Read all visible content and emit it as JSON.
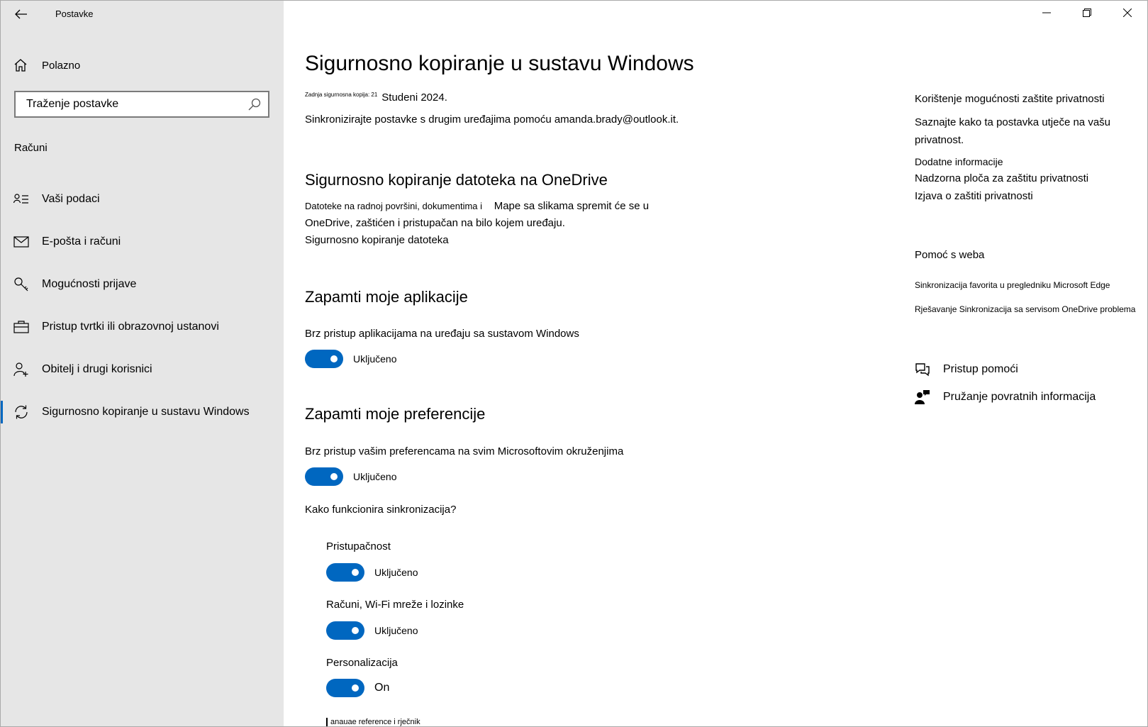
{
  "app": {
    "title": "Postavke"
  },
  "sidebar": {
    "home_label": "Polazno",
    "search_placeholder": "Traženje postavke",
    "section_label": "Računi",
    "items": [
      {
        "label": "Vaši podaci",
        "icon": "person-list-icon"
      },
      {
        "label": "E-pošta i računi",
        "icon": "mail-icon"
      },
      {
        "label": "Mogućnosti prijave",
        "icon": "key-icon"
      },
      {
        "label": "Pristup tvrtki ili obrazovnoj ustanovi",
        "icon": "briefcase-icon"
      },
      {
        "label": "Obitelj i drugi korisnici",
        "icon": "add-person-icon"
      },
      {
        "label": "Sigurnosno kopiranje u sustavu Windows",
        "icon": "sync-icon",
        "active": true
      }
    ]
  },
  "main": {
    "title": "Sigurnosno kopiranje u sustavu Windows",
    "last_backup_prefix": "Zadnja sigurnosna kopija: 21",
    "last_backup_date": "Studeni 2024.",
    "sync_description": "Sinkronizirajte postavke s drugim uređajima pomoću amanda.brady@outlook.it.",
    "onedrive": {
      "heading": "Sigurnosno kopiranje datoteka na OneDrive",
      "desc_part1": "Datoteke na radnoj površini, dokumentima i",
      "desc_part2": "Mape sa slikama spremit će se u",
      "desc_line2": "OneDrive, zaštićen i pristupačan na bilo kojem uređaju.",
      "link": "Sigurnosno kopiranje datoteka"
    },
    "apps": {
      "heading": "Zapamti moje aplikacije",
      "description": "Brz pristup aplikacijama na uređaju sa sustavom Windows",
      "toggle_label": "Uključeno",
      "toggle_on": true
    },
    "preferences": {
      "heading": "Zapamti moje preferencije",
      "description": "Brz pristup vašim preferencama na svim Microsoftovim okruženjima",
      "toggle_label": "Uključeno",
      "toggle_on": true,
      "how_sync_link": "Kako funkcionira sinkronizacija?",
      "sub_settings": [
        {
          "label": "Pristupačnost",
          "toggle_label": "Uključeno",
          "on": true
        },
        {
          "label": "Računi, Wi-Fi mreže i lozinke",
          "toggle_label": "Uključeno",
          "on": true
        },
        {
          "label": "Personalizacija",
          "toggle_label": "On",
          "on": true
        }
      ],
      "cut_off_label": "anauae reference i rječnik"
    }
  },
  "right_panel": {
    "privacy_heading": "Korištenje mogućnosti zaštite privatnosti",
    "privacy_text": "Saznajte kako ta postavka utječe na vašu privatnost.",
    "more_info": "Dodatne informacije",
    "privacy_dashboard": "Nadzorna ploča za zaštitu privatnosti",
    "privacy_statement": "Izjava o zaštiti privatnosti",
    "web_help_heading": "Pomoć s weba",
    "web_help_links": [
      "Sinkronizacija favorita u pregledniku Microsoft Edge",
      "Rješavanje Sinkronizacija sa servisom OneDrive problema"
    ],
    "get_help": "Pristup pomoći",
    "give_feedback": "Pružanje povratnih informacija"
  },
  "colors": {
    "accent": "#0067c0",
    "sidebar_bg": "#e6e6e6"
  }
}
